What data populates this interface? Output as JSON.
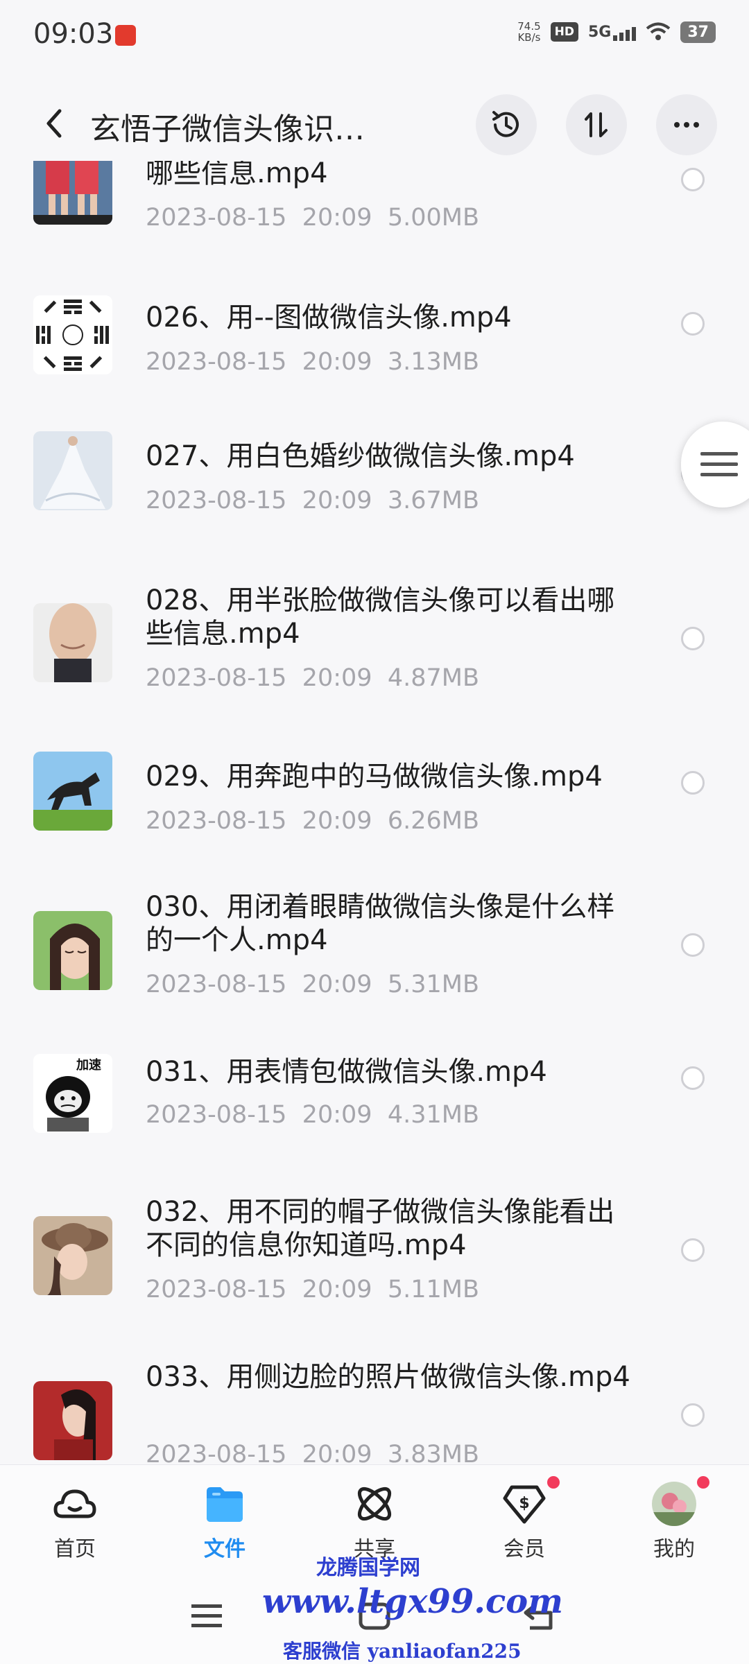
{
  "status_bar": {
    "time": "09:03",
    "net_speed_value": "74.5",
    "net_speed_unit": "KB/s",
    "hd": "HD",
    "network": "5G",
    "battery": "37"
  },
  "header": {
    "title": "玄悟子微信头像识…"
  },
  "files": [
    {
      "name": "哪些信息.mp4",
      "date": "2023-08-15",
      "time": "20:09",
      "size": "5.00MB",
      "thumb": "legs"
    },
    {
      "name": "026、用--图做微信头像.mp4",
      "date": "2023-08-15",
      "time": "20:09",
      "size": "3.13MB",
      "thumb": "bagua"
    },
    {
      "name": "027、用白色婚纱做微信头像.mp4",
      "date": "2023-08-15",
      "time": "20:09",
      "size": "3.67MB",
      "thumb": "wedding-dress"
    },
    {
      "name": "028、用半张脸做微信头像可以看出哪些信息.mp4",
      "date": "2023-08-15",
      "time": "20:09",
      "size": "4.87MB",
      "thumb": "half-face"
    },
    {
      "name": "029、用奔跑中的马做微信头像.mp4",
      "date": "2023-08-15",
      "time": "20:09",
      "size": "6.26MB",
      "thumb": "horse"
    },
    {
      "name": "030、用闭着眼睛做微信头像是什么样的一个人.mp4",
      "date": "2023-08-15",
      "time": "20:09",
      "size": "5.31MB",
      "thumb": "girl"
    },
    {
      "name": "031、用表情包做微信头像.mp4",
      "date": "2023-08-15",
      "time": "20:09",
      "size": "4.31MB",
      "thumb": "meme",
      "thumb_text": "加速"
    },
    {
      "name": "032、用不同的帽子做微信头像能看出不同的信息你知道吗.mp4",
      "date": "2023-08-15",
      "time": "20:09",
      "size": "5.11MB",
      "thumb": "hat"
    },
    {
      "name": "033、用侧边脸的照片做微信头像.mp4",
      "date": "2023-08-15",
      "time": "20:09",
      "size": "3.83MB",
      "thumb": "side-face"
    }
  ],
  "bottom_nav": [
    {
      "label": "首页",
      "icon": "home-cloud-icon"
    },
    {
      "label": "文件",
      "icon": "folder-icon",
      "active": true
    },
    {
      "label": "共享",
      "icon": "atom-share-icon"
    },
    {
      "label": "会员",
      "icon": "member-diamond-icon",
      "badge": true
    },
    {
      "label": "我的",
      "icon": "avatar",
      "badge": true
    }
  ],
  "watermark": {
    "line1": "龙腾国学网",
    "line2": "www.ltgx99.com",
    "line3": "客服微信 yanliaofan225"
  },
  "colors": {
    "accent": "#1f8cf0",
    "badge": "#f23b5c",
    "watermark": "#2d3fcf"
  }
}
